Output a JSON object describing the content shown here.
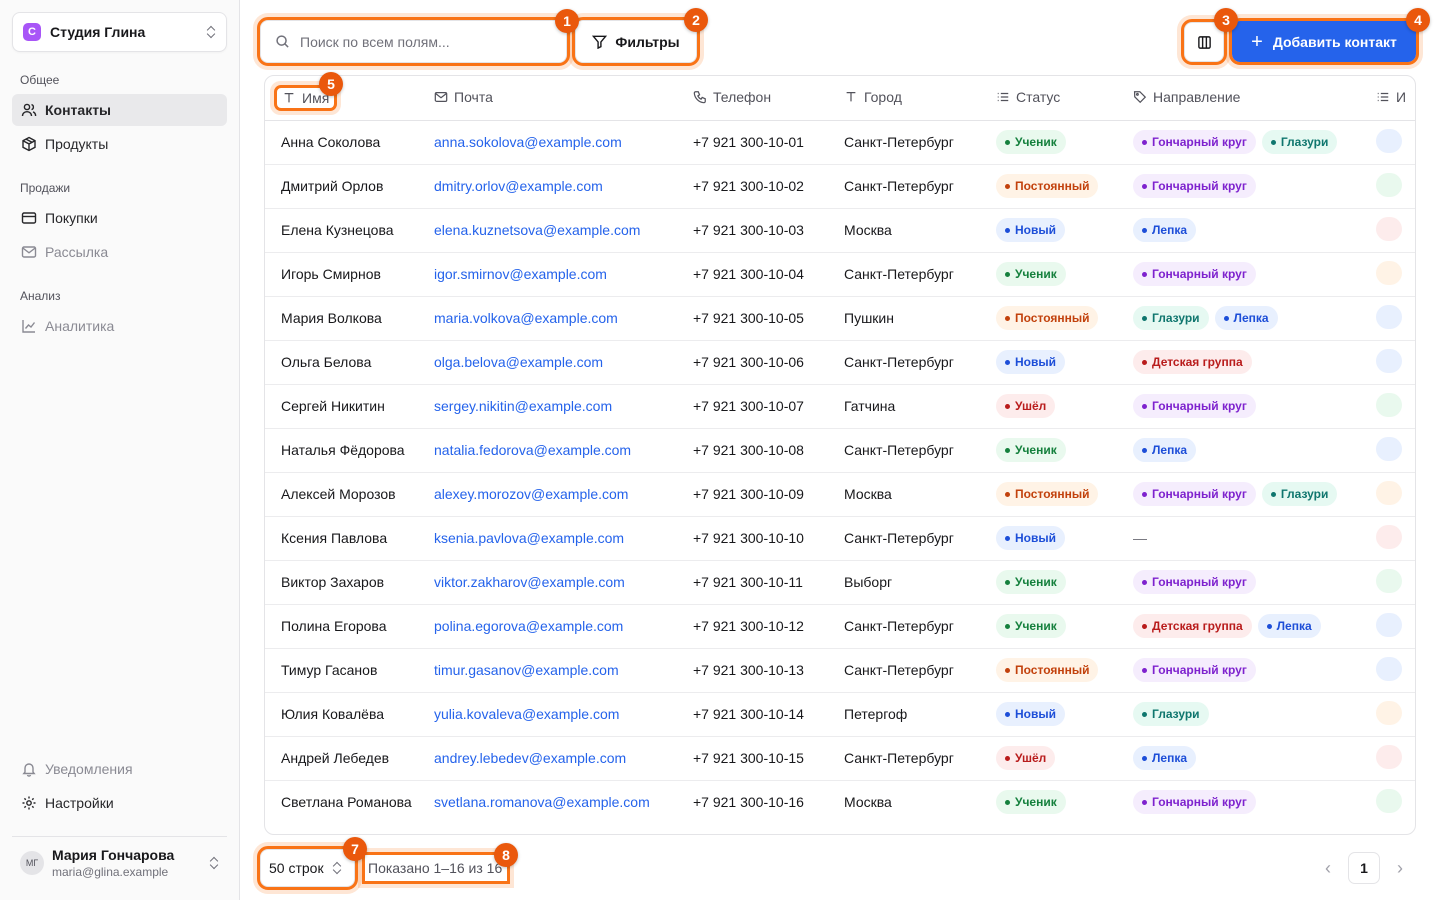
{
  "sidebar": {
    "org": {
      "logo_letter": "С",
      "name": "Студия Глина"
    },
    "sections": {
      "general": "Общее",
      "sales": "Продажи",
      "analysis": "Анализ"
    },
    "items": {
      "contacts": "Контакты",
      "products": "Продукты",
      "purchases": "Покупки",
      "mailing": "Рассылка",
      "analytics": "Аналитика",
      "notifications": "Уведомления",
      "settings": "Настройки"
    },
    "user": {
      "initials": "МГ",
      "name": "Мария Гончарова",
      "email": "maria@glina.example"
    }
  },
  "toolbar": {
    "search_placeholder": "Поиск по всем полям...",
    "filters_label": "Фильтры",
    "add_label": "Добавить контакт"
  },
  "markers": [
    "1",
    "2",
    "3",
    "4",
    "5",
    "7",
    "8"
  ],
  "table": {
    "columns": {
      "name": "Имя",
      "email": "Почта",
      "phone": "Телефон",
      "city": "Город",
      "status": "Статус",
      "direction": "Направление",
      "extra": "И"
    },
    "empty_value": "—",
    "rows": [
      {
        "name": "Анна Соколова",
        "email": "anna.sokolova@example.com",
        "phone": "+7 921 300-10-01",
        "city": "Санкт-Петербург",
        "status": "Ученик",
        "directions": [
          "Гончарный круг",
          "Глазури"
        ]
      },
      {
        "name": "Дмитрий Орлов",
        "email": "dmitry.orlov@example.com",
        "phone": "+7 921 300-10-02",
        "city": "Санкт-Петербург",
        "status": "Постоянный",
        "directions": [
          "Гончарный круг"
        ]
      },
      {
        "name": "Елена Кузнецова",
        "email": "elena.kuznetsova@example.com",
        "phone": "+7 921 300-10-03",
        "city": "Москва",
        "status": "Новый",
        "directions": [
          "Лепка"
        ]
      },
      {
        "name": "Игорь Смирнов",
        "email": "igor.smirnov@example.com",
        "phone": "+7 921 300-10-04",
        "city": "Санкт-Петербург",
        "status": "Ученик",
        "directions": [
          "Гончарный круг"
        ]
      },
      {
        "name": "Мария Волкова",
        "email": "maria.volkova@example.com",
        "phone": "+7 921 300-10-05",
        "city": "Пушкин",
        "status": "Постоянный",
        "directions": [
          "Глазури",
          "Лепка"
        ]
      },
      {
        "name": "Ольга Белова",
        "email": "olga.belova@example.com",
        "phone": "+7 921 300-10-06",
        "city": "Санкт-Петербург",
        "status": "Новый",
        "directions": [
          "Детская группа"
        ]
      },
      {
        "name": "Сергей Никитин",
        "email": "sergey.nikitin@example.com",
        "phone": "+7 921 300-10-07",
        "city": "Гатчина",
        "status": "Ушёл",
        "directions": [
          "Гончарный круг"
        ]
      },
      {
        "name": "Наталья Фёдорова",
        "email": "natalia.fedorova@example.com",
        "phone": "+7 921 300-10-08",
        "city": "Санкт-Петербург",
        "status": "Ученик",
        "directions": [
          "Лепка"
        ]
      },
      {
        "name": "Алексей Морозов",
        "email": "alexey.morozov@example.com",
        "phone": "+7 921 300-10-09",
        "city": "Москва",
        "status": "Постоянный",
        "directions": [
          "Гончарный круг",
          "Глазури"
        ]
      },
      {
        "name": "Ксения Павлова",
        "email": "ksenia.pavlova@example.com",
        "phone": "+7 921 300-10-10",
        "city": "Санкт-Петербург",
        "status": "Новый",
        "directions": []
      },
      {
        "name": "Виктор Захаров",
        "email": "viktor.zakharov@example.com",
        "phone": "+7 921 300-10-11",
        "city": "Выборг",
        "status": "Ученик",
        "directions": [
          "Гончарный круг"
        ]
      },
      {
        "name": "Полина Егорова",
        "email": "polina.egorova@example.com",
        "phone": "+7 921 300-10-12",
        "city": "Санкт-Петербург",
        "status": "Ученик",
        "directions": [
          "Детская группа",
          "Лепка"
        ]
      },
      {
        "name": "Тимур Гасанов",
        "email": "timur.gasanov@example.com",
        "phone": "+7 921 300-10-13",
        "city": "Санкт-Петербург",
        "status": "Постоянный",
        "directions": [
          "Гончарный круг"
        ]
      },
      {
        "name": "Юлия Ковалёва",
        "email": "yulia.kovaleva@example.com",
        "phone": "+7 921 300-10-14",
        "city": "Петергоф",
        "status": "Новый",
        "directions": [
          "Глазури"
        ]
      },
      {
        "name": "Андрей Лебедев",
        "email": "andrey.lebedev@example.com",
        "phone": "+7 921 300-10-15",
        "city": "Санкт-Петербург",
        "status": "Ушёл",
        "directions": [
          "Лепка"
        ]
      },
      {
        "name": "Светлана Романова",
        "email": "svetlana.romanova@example.com",
        "phone": "+7 921 300-10-16",
        "city": "Москва",
        "status": "Ученик",
        "directions": [
          "Гончарный круг"
        ]
      }
    ],
    "extra_colors": [
      "blue",
      "green",
      "red",
      "orange",
      "blue",
      "blue",
      "green",
      "blue",
      "orange",
      "red",
      "green",
      "blue",
      "blue",
      "orange",
      "red",
      "green"
    ]
  },
  "footer": {
    "rows_per_page": "50 строк",
    "shown_text": "Показано 1–16 из 16",
    "current_page": "1",
    "prev_icon": "‹",
    "next_icon": "›"
  },
  "colors": {
    "accent": "#2563eb",
    "highlight": "#f97316",
    "status": {
      "Ученик": "green",
      "Постоянный": "orange",
      "Новый": "blue",
      "Ушёл": "red"
    },
    "direction": {
      "Гончарный круг": "purple",
      "Глазури": "teal",
      "Лепка": "blue",
      "Детская группа": "red"
    }
  }
}
